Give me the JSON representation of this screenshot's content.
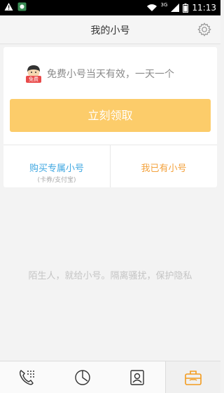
{
  "status_bar": {
    "network": "3G",
    "time": "11:13"
  },
  "header": {
    "title": "我的小号",
    "settings_icon": "gear-icon"
  },
  "card": {
    "mascot_badge": "免费",
    "promo_text": "免费小号当天有效，一天一个",
    "cta_label": "立刻领取",
    "buy_label": "购买专属小号",
    "buy_sub": "(卡券/支付宝)",
    "have_label": "我已有小号"
  },
  "tagline": "陌生人，就给小号。隔离骚扰，保护隐私",
  "bottom_nav": {
    "tabs": [
      {
        "icon": "dialpad-icon",
        "active": false
      },
      {
        "icon": "clock-icon",
        "active": false
      },
      {
        "icon": "contacts-icon",
        "active": false
      },
      {
        "icon": "briefcase-icon",
        "active": true
      }
    ]
  },
  "colors": {
    "cta": "#fccc6a",
    "buy_link": "#3fa7e1",
    "have_link": "#f3a23d",
    "active_tab_icon": "#f39c1f"
  }
}
